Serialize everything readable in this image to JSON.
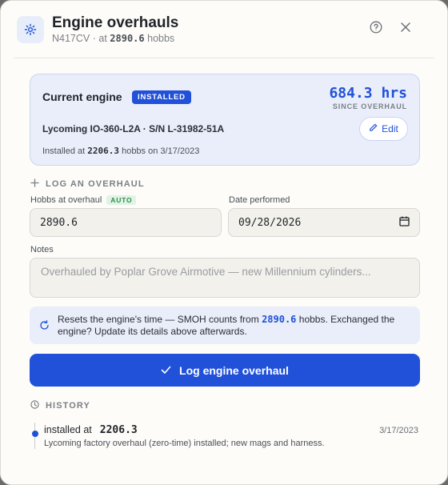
{
  "header": {
    "title": "Engine overhauls",
    "tail_number": "N417CV",
    "at_label": "· at",
    "hobbs": "2890.6",
    "hobbs_unit": "hobbs",
    "icon": "gear-icon",
    "help_icon": "help-circle-icon",
    "close_icon": "close-icon"
  },
  "current_engine": {
    "title": "Current engine",
    "badge": "INSTALLED",
    "hours": "684.3 hrs",
    "hours_caption": "SINCE OVERHAUL",
    "model": "Lycoming IO-360-L2A · S/N L-31982-51A",
    "edit_label": "Edit",
    "installed_prefix": "Installed at",
    "installed_hobbs": "2206.3",
    "installed_suffix": "hobbs on 3/17/2023"
  },
  "log_form": {
    "section_label": "LOG AN OVERHAUL",
    "hobbs_label": "Hobbs at overhaul",
    "auto_badge": "AUTO",
    "hobbs_value": "2890.6",
    "date_label": "Date performed",
    "date_value": "09/28/2026",
    "notes_label": "Notes",
    "notes_placeholder": "Overhauled by Poplar Grove Airmotive — new Millennium cylinders...",
    "info_prefix": "Resets the engine's time — SMOH counts from",
    "info_hobbs": "2890.6",
    "info_suffix": "hobbs. Exchanged the engine? Update its details above afterwards.",
    "submit_label": "Log engine overhaul"
  },
  "history": {
    "section_label": "HISTORY",
    "items": [
      {
        "title_prefix": "installed at",
        "hobbs": "2206.3",
        "date": "3/17/2023",
        "description": "Lycoming factory overhaul (zero-time) installed; new mags and harness."
      }
    ]
  },
  "colors": {
    "accent": "#2051d8",
    "card_bg": "#e9eefa",
    "auto_badge": "#2f8f4b"
  }
}
